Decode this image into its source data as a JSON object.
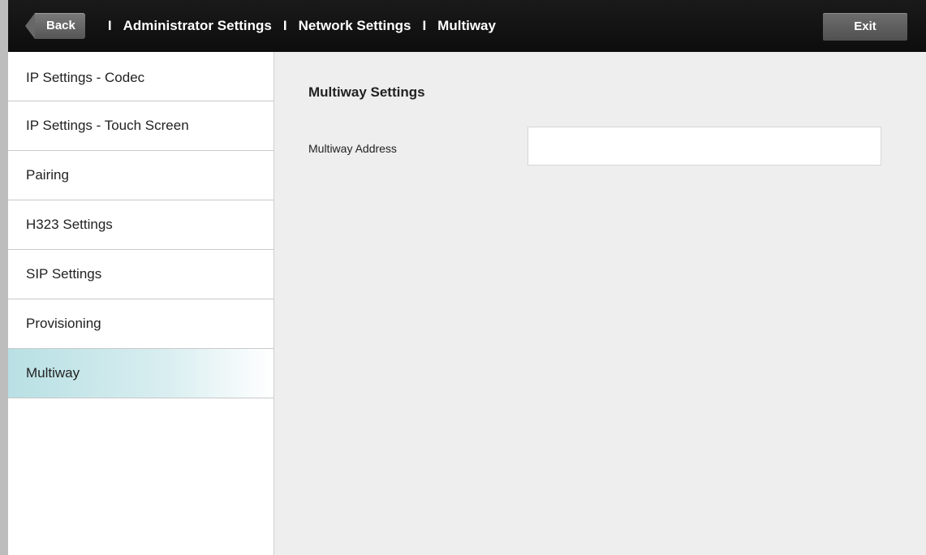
{
  "header": {
    "back_label": "Back",
    "breadcrumbs": [
      "Administrator Settings",
      "Network Settings",
      "Multiway"
    ],
    "separator": "I",
    "exit_label": "Exit"
  },
  "sidebar": {
    "items": [
      {
        "label": "IP Settings - Codec",
        "active": false
      },
      {
        "label": "IP Settings - Touch Screen",
        "active": false
      },
      {
        "label": "Pairing",
        "active": false
      },
      {
        "label": "H323 Settings",
        "active": false
      },
      {
        "label": "SIP Settings",
        "active": false
      },
      {
        "label": "Provisioning",
        "active": false
      },
      {
        "label": "Multiway",
        "active": true
      }
    ]
  },
  "main": {
    "section_title": "Multiway Settings",
    "fields": {
      "multiway_address": {
        "label": "Multiway Address",
        "value": "",
        "placeholder": ""
      }
    }
  },
  "colors": {
    "topbar": "#111111",
    "active_item": "#b8e0e4",
    "background": "#eeeeee"
  }
}
